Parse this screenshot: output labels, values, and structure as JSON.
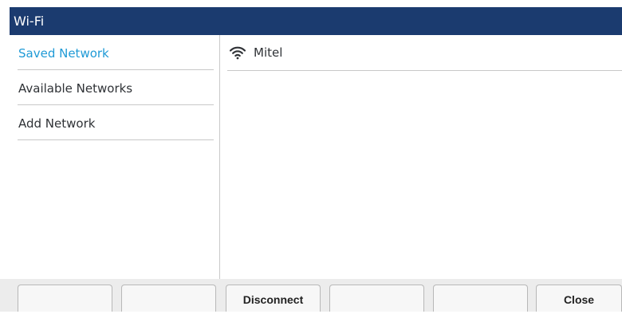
{
  "window": {
    "title": "Wi-Fi"
  },
  "sidebar": {
    "items": [
      {
        "label": "Saved Network",
        "active": true
      },
      {
        "label": "Available Networks",
        "active": false
      },
      {
        "label": "Add Network",
        "active": false
      }
    ]
  },
  "networks": [
    {
      "name": "Mitel",
      "icon": "wifi-icon"
    }
  ],
  "softkeys": [
    {
      "label": ""
    },
    {
      "label": ""
    },
    {
      "label": "Disconnect"
    },
    {
      "label": ""
    },
    {
      "label": ""
    },
    {
      "label": "Close"
    }
  ],
  "colors": {
    "title_bar": "#1b3b6f",
    "active_item": "#1f9ad6"
  }
}
